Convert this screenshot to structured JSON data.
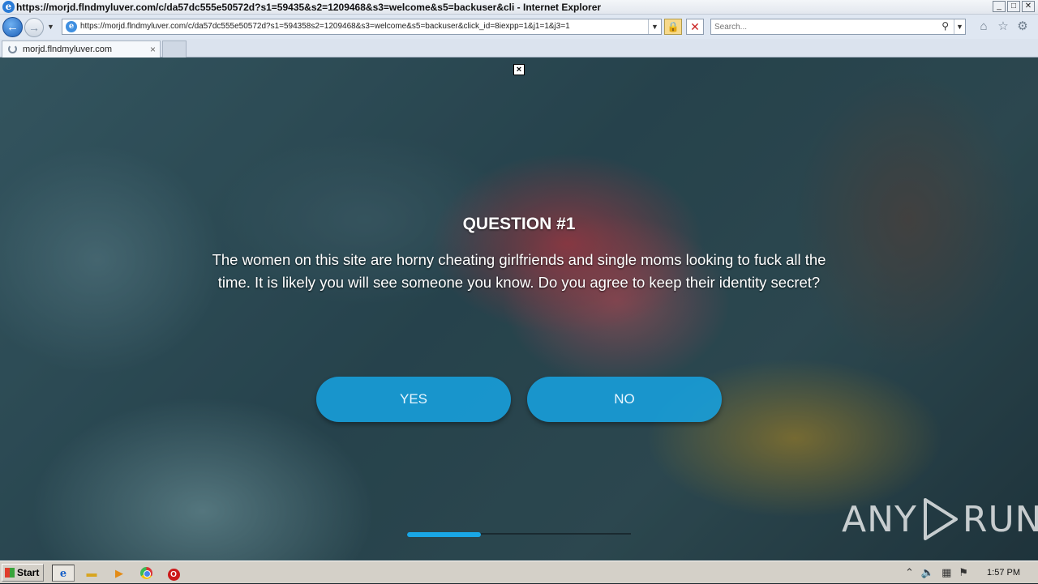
{
  "window": {
    "title": "https://morjd.flndmyluver.com/c/da57dc555e50572d?s1=59435&s2=1209468&s3=welcome&s5=backuser&cli - Internet Explorer",
    "buttons": {
      "minimize": "_",
      "maximize": "□",
      "close": "✕"
    }
  },
  "navbar": {
    "url": "https://morjd.flndmyluver.com/c/da57dc555e50572d?s1=594358s2=1209468&s3=welcome&s5=backuser&click_id=8iexpp=1&j1=1&j3=1",
    "search_placeholder": "Search...",
    "icons": {
      "back": "back-arrow-icon",
      "forward": "forward-arrow-icon",
      "lock": "lock-icon",
      "stop": "stop-icon",
      "search": "magnifier-icon",
      "home": "home-icon",
      "favorites": "star-icon",
      "tools": "gear-icon"
    }
  },
  "tabs": [
    {
      "title": "morjd.flndmyluver.com",
      "loading": true,
      "close": "×"
    }
  ],
  "page": {
    "close_ad": "×",
    "question_title": "QUESTION #1",
    "question_text": "The women on this site are horny cheating girlfriends and single moms looking to fuck all the time. It is likely you will see someone you know. Do you agree to keep their identity secret?",
    "answers": [
      "YES",
      "NO"
    ],
    "progress_fraction": 0.33,
    "accent_color": "#19a7e6",
    "watermark": {
      "left": "ANY",
      "right": "RUN"
    }
  },
  "taskbar": {
    "start_label": "Start",
    "apps": [
      "internet-explorer-icon",
      "folder-icon",
      "media-player-icon",
      "chrome-icon",
      "opera-icon"
    ],
    "clock": "1:57 PM"
  }
}
